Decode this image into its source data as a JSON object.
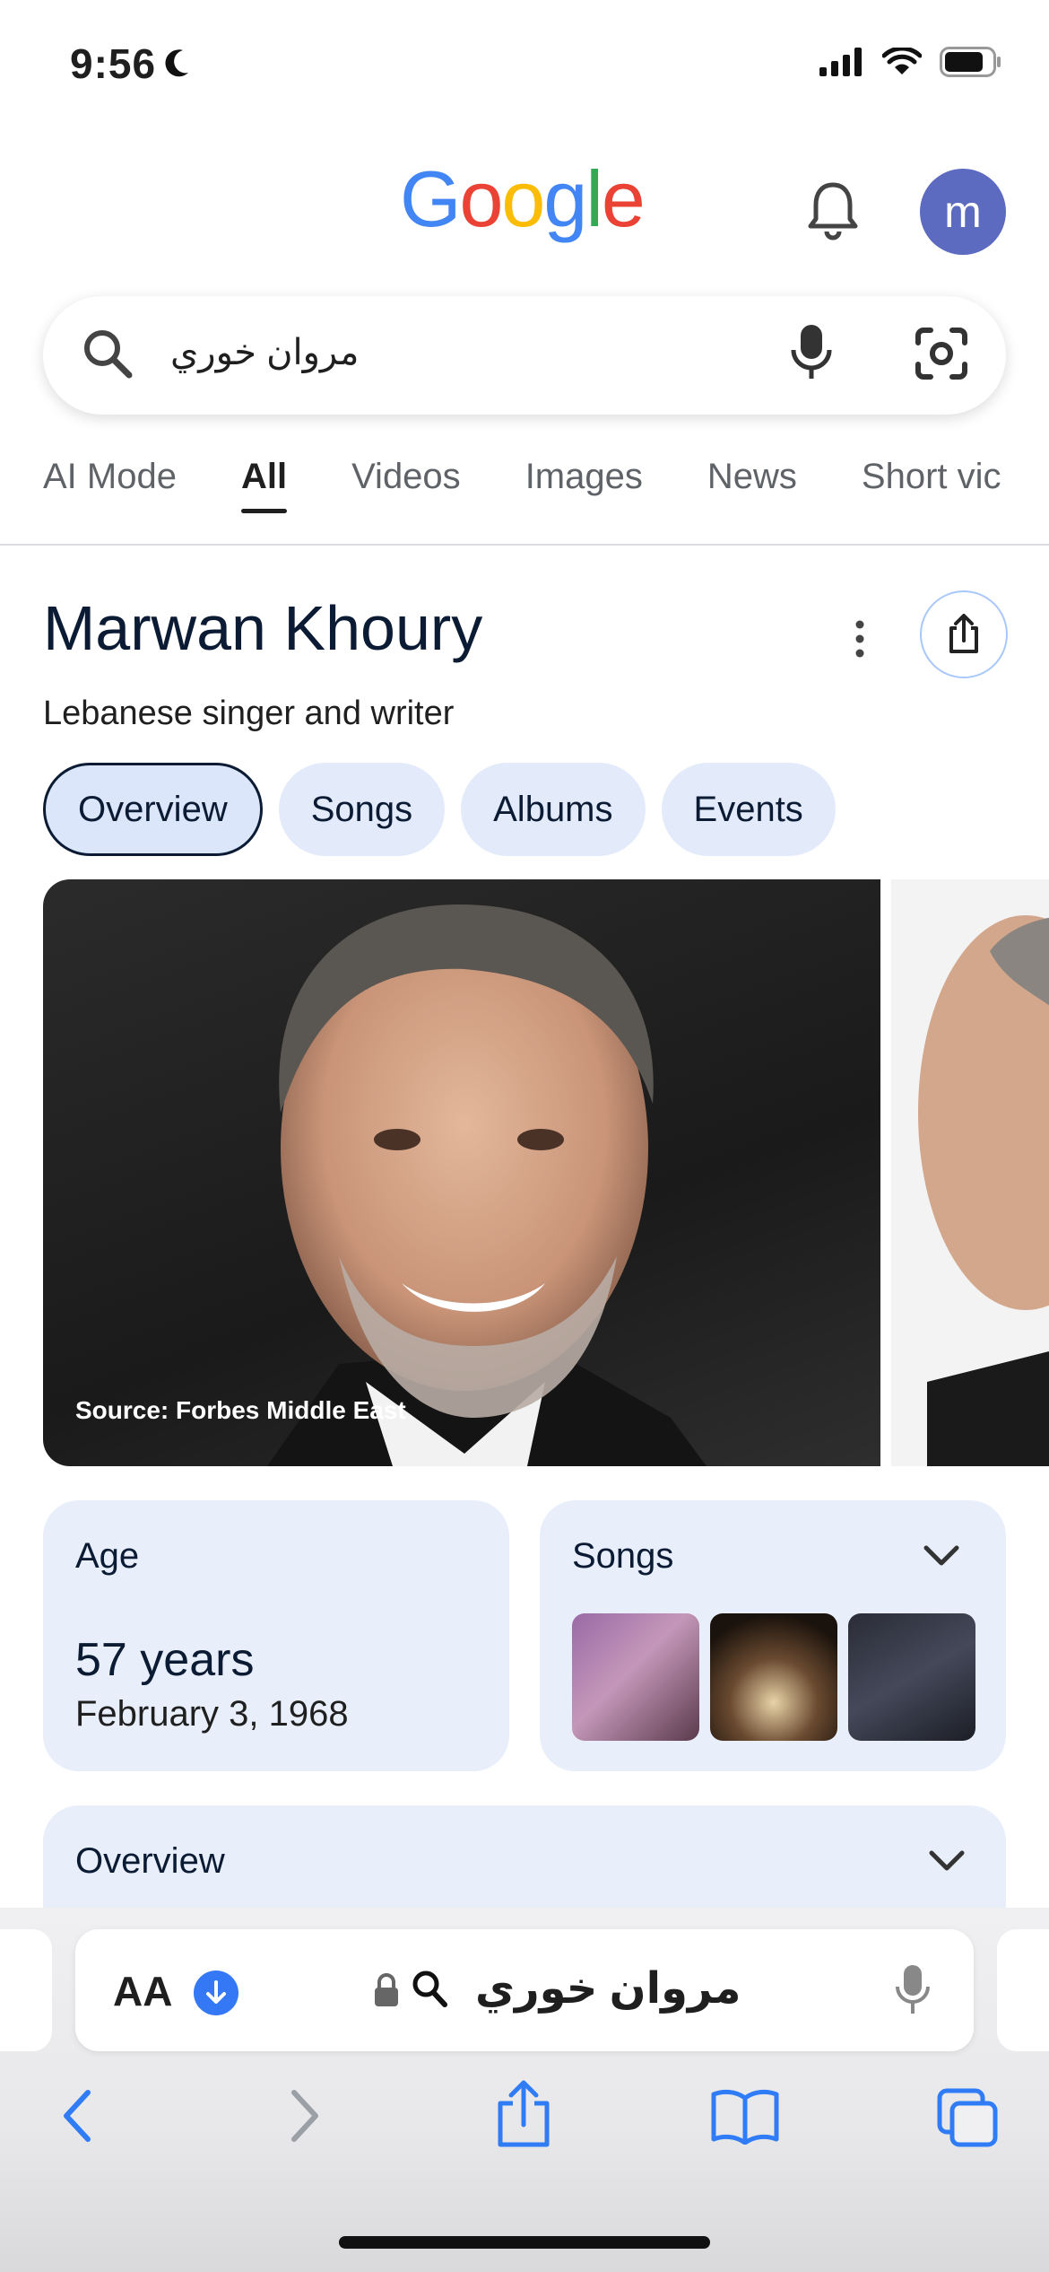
{
  "status_bar": {
    "time": "9:56"
  },
  "header": {
    "logo_letters": [
      "G",
      "o",
      "o",
      "g",
      "l",
      "e"
    ],
    "avatar_letter": "m"
  },
  "search": {
    "query": "مروان خوري"
  },
  "tabs": [
    {
      "label": "AI Mode",
      "active": false
    },
    {
      "label": "All",
      "active": true
    },
    {
      "label": "Videos",
      "active": false
    },
    {
      "label": "Images",
      "active": false
    },
    {
      "label": "News",
      "active": false
    },
    {
      "label": "Short vic",
      "active": false
    }
  ],
  "entity": {
    "title": "Marwan Khoury",
    "subtitle": "Lebanese singer and writer",
    "chips": [
      "Overview",
      "Songs",
      "Albums",
      "Events"
    ],
    "image_source": "Source: Forbes Middle East"
  },
  "age_card": {
    "label": "Age",
    "value": "57 years",
    "birth_date": "February 3, 1968"
  },
  "songs_card": {
    "label": "Songs"
  },
  "overview_card": {
    "label": "Overview"
  },
  "browser": {
    "aa_label": "AA",
    "url_text": "مروان خوري"
  },
  "icons": [
    "moon-icon",
    "signal-icon",
    "wifi-icon",
    "battery-icon",
    "bell-icon",
    "search-icon",
    "mic-icon",
    "lens-icon",
    "more-vert-icon",
    "share-icon",
    "chevron-down-icon",
    "lock-icon",
    "back-icon",
    "forward-icon",
    "bookmarks-icon",
    "tabs-icon"
  ],
  "colors": {
    "accent": "#3478f6",
    "chip_bg": "#e3ebfb",
    "card_bg": "#e8effb",
    "avatar_bg": "#5c6bc0"
  }
}
